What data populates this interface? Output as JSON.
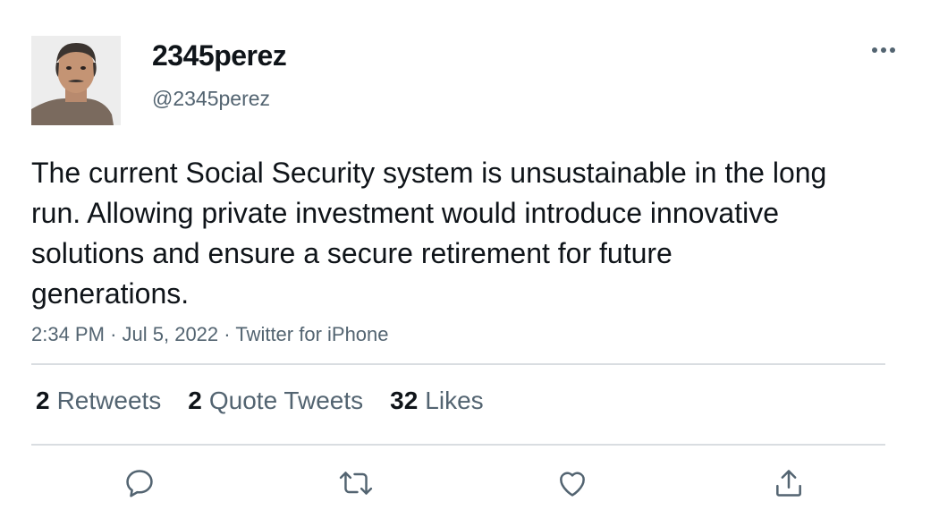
{
  "author": {
    "display_name": "2345perez",
    "handle": "@2345perez"
  },
  "tweet": {
    "text": "The current Social Security system is unsustainable in the long run. Allowing private investment would introduce innovative solutions and ensure a secure retirement for future generations.",
    "time": "2:34 PM",
    "separator_1": "·",
    "date": "Jul 5, 2022",
    "separator_2": "·",
    "source": "Twitter for iPhone"
  },
  "stats": {
    "retweets_count": "2",
    "retweets_label": "Retweets",
    "quotes_count": "2",
    "quotes_label": "Quote Tweets",
    "likes_count": "32",
    "likes_label": "Likes"
  },
  "icons": {
    "more": "more-horizontal-icon",
    "reply": "reply-icon",
    "retweet": "retweet-icon",
    "like": "heart-icon",
    "share": "share-icon"
  },
  "colors": {
    "text": "#0f1419",
    "secondary": "#536471",
    "divider": "#d9dde1"
  }
}
